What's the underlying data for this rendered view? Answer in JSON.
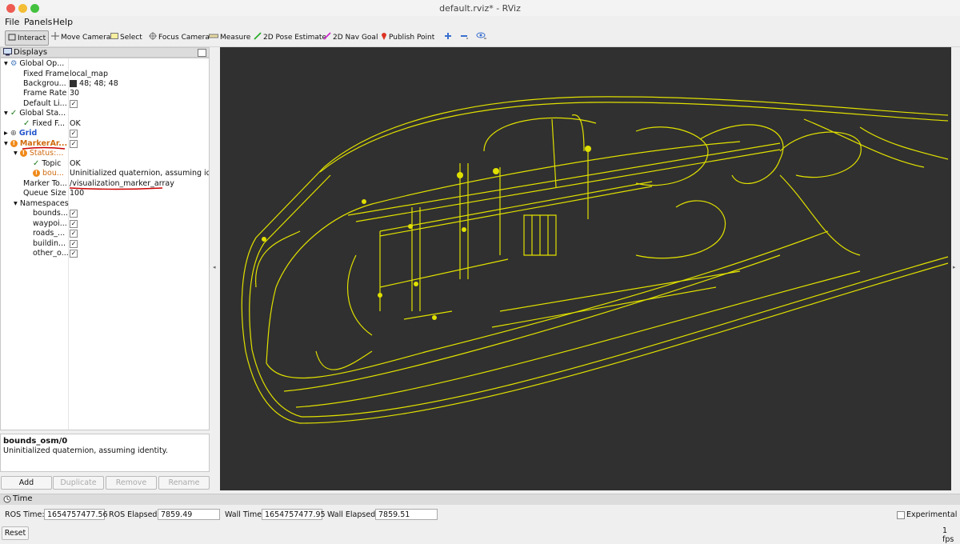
{
  "window": {
    "title": "default.rviz* - RViz"
  },
  "menu": {
    "items": [
      "File",
      "Panels",
      "Help"
    ]
  },
  "toolbar": {
    "interact": "Interact",
    "move_camera": "Move Camera",
    "select": "Select",
    "focus_camera": "Focus Camera",
    "measure": "Measure",
    "pose_estimate": "2D Pose Estimate",
    "nav_goal": "2D Nav Goal",
    "publish_point": "Publish Point"
  },
  "displays": {
    "header": "Displays",
    "rows": {
      "global_options": "Global Op...",
      "fixed_frame_label": "Fixed Frame",
      "fixed_frame_value": "local_map",
      "background_label": "Backgrou...",
      "background_value": "48; 48; 48",
      "background_color": "#303030",
      "frame_rate_label": "Frame Rate",
      "frame_rate_value": "30",
      "default_light_label": "Default Li...",
      "global_status": "Global Sta...",
      "fixed_f_label": "Fixed F...",
      "fixed_f_value": "OK",
      "grid": "Grid",
      "marker_array": "MarkerAr...",
      "status": "Status:...",
      "topic_label": "Topic",
      "topic_value": "OK",
      "bou_label": "bou...",
      "bou_value": "Uninitialized quaternion, assuming ide...",
      "marker_topic_label": "Marker To...",
      "marker_topic_value": "/visualization_marker_array",
      "queue_size_label": "Queue Size",
      "queue_size_value": "100",
      "namespaces": "Namespaces",
      "ns_bounds": "bounds...",
      "ns_waypoints": "waypoi...",
      "ns_roads": "roads_...",
      "ns_buildings": "buildin...",
      "ns_other": "other_o..."
    }
  },
  "description": {
    "title": "bounds_osm/0",
    "text": "Uninitialized quaternion, assuming identity."
  },
  "buttons": {
    "add": "Add",
    "duplicate": "Duplicate",
    "remove": "Remove",
    "rename": "Rename"
  },
  "time": {
    "header": "Time",
    "ros_time_label": "ROS Time:",
    "ros_time_value": "1654757477.56",
    "ros_elapsed_label": "ROS Elapsed:",
    "ros_elapsed_value": "7859.49",
    "wall_time_label": "Wall Time:",
    "wall_time_value": "1654757477.95",
    "wall_elapsed_label": "Wall Elapsed:",
    "wall_elapsed_value": "7859.51",
    "experimental_label": "Experimental",
    "reset": "Reset",
    "fps": "1 fps"
  },
  "colors": {
    "marker": "#e0e000",
    "warning": "#f08a1a",
    "ok": "#1a7a1a",
    "annotation": "#cc0000",
    "grid_label": "#2255cc"
  }
}
